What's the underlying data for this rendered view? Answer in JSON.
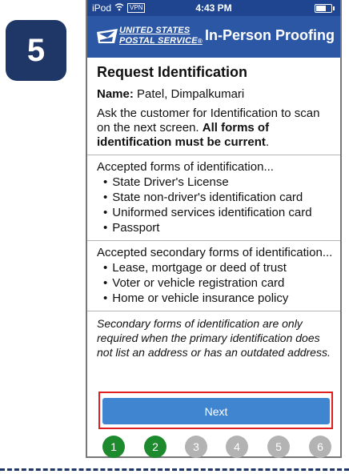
{
  "step_badge": "5",
  "status_bar": {
    "device": "iPod",
    "vpn": "VPN",
    "time": "4:43 PM"
  },
  "header": {
    "logo_line1": "UNITED STATES",
    "logo_line2": "POSTAL SERVICE",
    "logo_reg": "®",
    "title": "In-Person Proofing"
  },
  "main": {
    "heading": "Request Identification",
    "name_label": "Name:",
    "name_value": "Patel, Dimpalkumari",
    "instruction_prefix": "Ask the customer for Identification to scan on the next screen. ",
    "instruction_bold": "All forms of identification must be current",
    "instruction_suffix": ".",
    "accepted_heading": "Accepted forms of identification...",
    "accepted_items": [
      "State Driver's License",
      "State non-driver's identification card",
      "Uniformed services identification card",
      "Passport"
    ],
    "secondary_heading": "Accepted secondary forms of identification...",
    "secondary_items": [
      "Lease, mortgage or deed of trust",
      "Voter or vehicle registration card",
      "Home or vehicle insurance policy"
    ],
    "note": "Secondary forms of identification are only required when the primary identification does not list an address or has an outdated address."
  },
  "next_button": "Next",
  "progress": {
    "steps": [
      "1",
      "2",
      "3",
      "4",
      "5",
      "6"
    ],
    "completed": 2
  },
  "colors": {
    "badge": "#1f3766",
    "header": "#2b57a5",
    "status_bar": "#1f4590",
    "button": "#3f85d0",
    "highlight": "#e02020",
    "step_done": "#1e8a2e",
    "step_todo": "#b3b3b3"
  }
}
